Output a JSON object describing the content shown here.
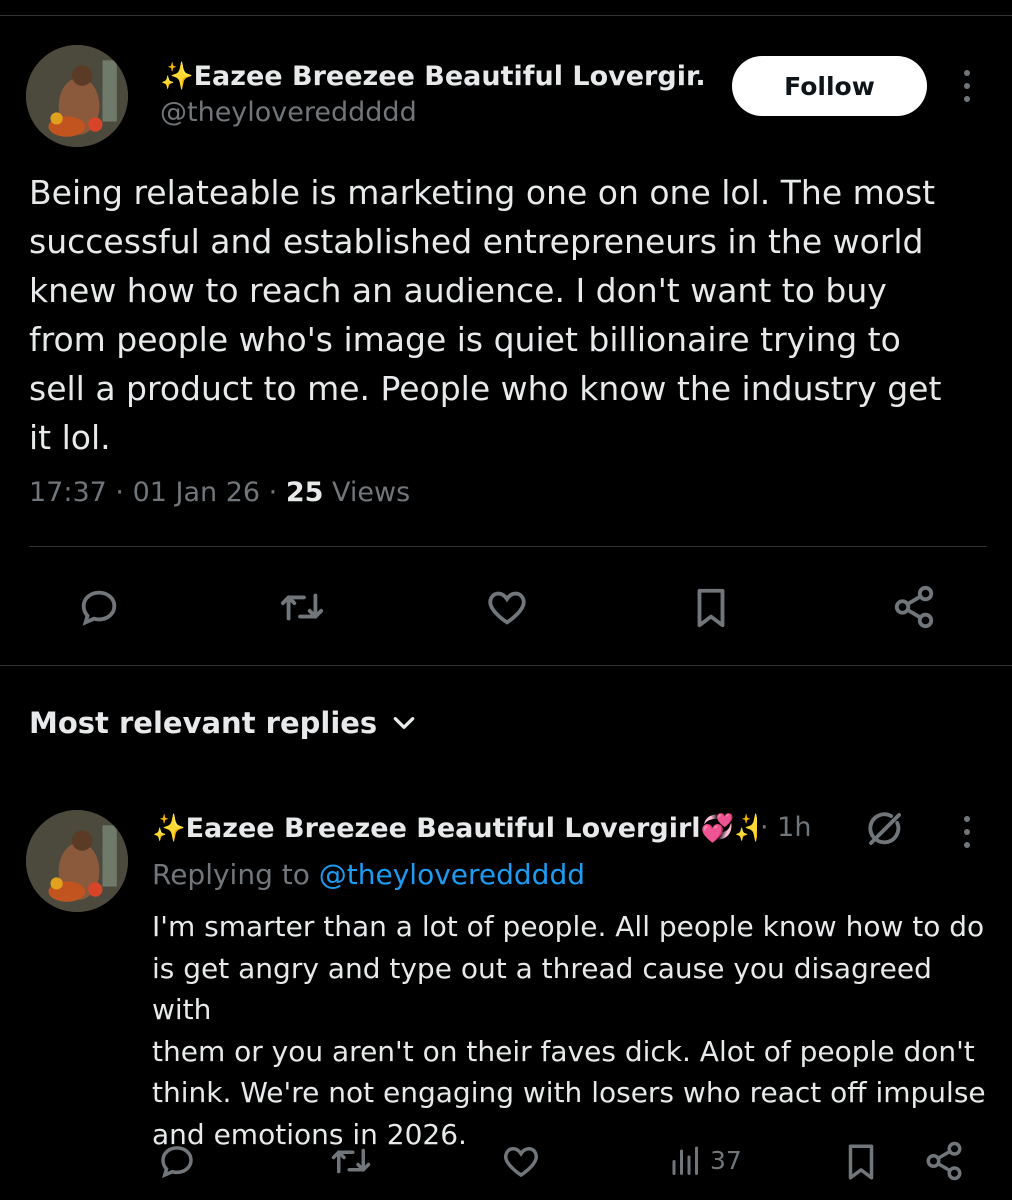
{
  "post": {
    "author_name": "✨Eazee Breezee Beautiful Lovergir...",
    "author_handle": "@theylovereddddd",
    "follow_label": "Follow",
    "text": "Being relateable is marketing one on one lol. The most\nsuccessful and established entrepreneurs in the world\nknew how to reach an audience. I don't want to buy\nfrom people who's image is quiet billionaire trying to\nsell a product to me. People who know the industry get\nit lol.",
    "time": "17:37",
    "date": "01 Jan 26",
    "views_count": "25",
    "views_label": "Views"
  },
  "actions": [
    "reply-icon",
    "repost-icon",
    "like-icon",
    "bookmark-icon",
    "share-icon"
  ],
  "replies_section": {
    "sort_label": "Most relevant replies"
  },
  "reply": {
    "author_name": "✨Eazee Breezee Beautiful Lovergirl💞✨",
    "time": "· 1h",
    "replying_prefix": "Replying to",
    "replying_handle": "@theylovereddddd",
    "text": "I'm smarter than a lot of people. All people know how to do\nis get angry and type out a thread cause you disagreed with\nthem or you aren't on their faves dick. Alot of people don't\nthink. We're not engaging with losers who react off impulse\nand emotions in 2026.",
    "views": "37"
  },
  "colors": {
    "background": "#000000",
    "text": "#e7e9ea",
    "secondary": "#71767b",
    "link": "#1d9bf0",
    "divider": "#2f3336"
  }
}
